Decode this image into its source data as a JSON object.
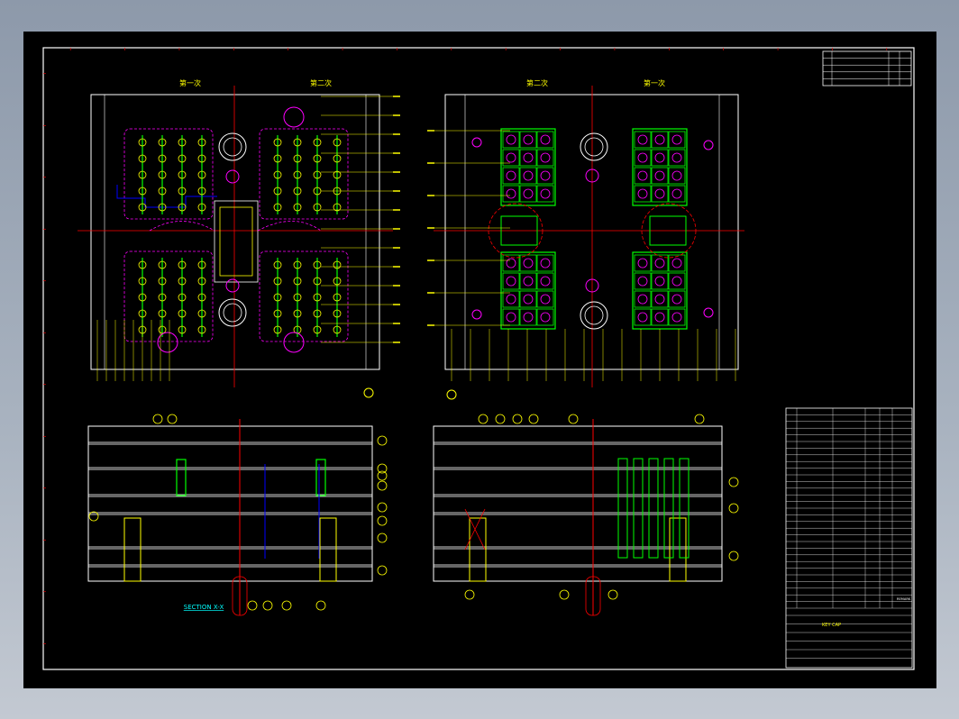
{
  "plan_headings": {
    "left_first": "第一次",
    "left_second": "第二次",
    "right_second": "第二次",
    "right_first": "第一次"
  },
  "section_label": "SECTION X-X",
  "title_block": {
    "part_name": "KEY CAP",
    "remark": "REMARK"
  },
  "colors": {
    "background": "#000000",
    "frame": "#ffffff",
    "outline": "#ffff00",
    "center_line": "#ff0000",
    "cavity": "#00ff00",
    "hole": "#ff00ff",
    "cooling": "#00ffff",
    "ejector": "#0000ff"
  },
  "icons": {
    "view_marker_left": "view-marker-icon",
    "view_marker_right": "view-marker-icon",
    "revision_triangle": "revision-triangle-icon"
  }
}
